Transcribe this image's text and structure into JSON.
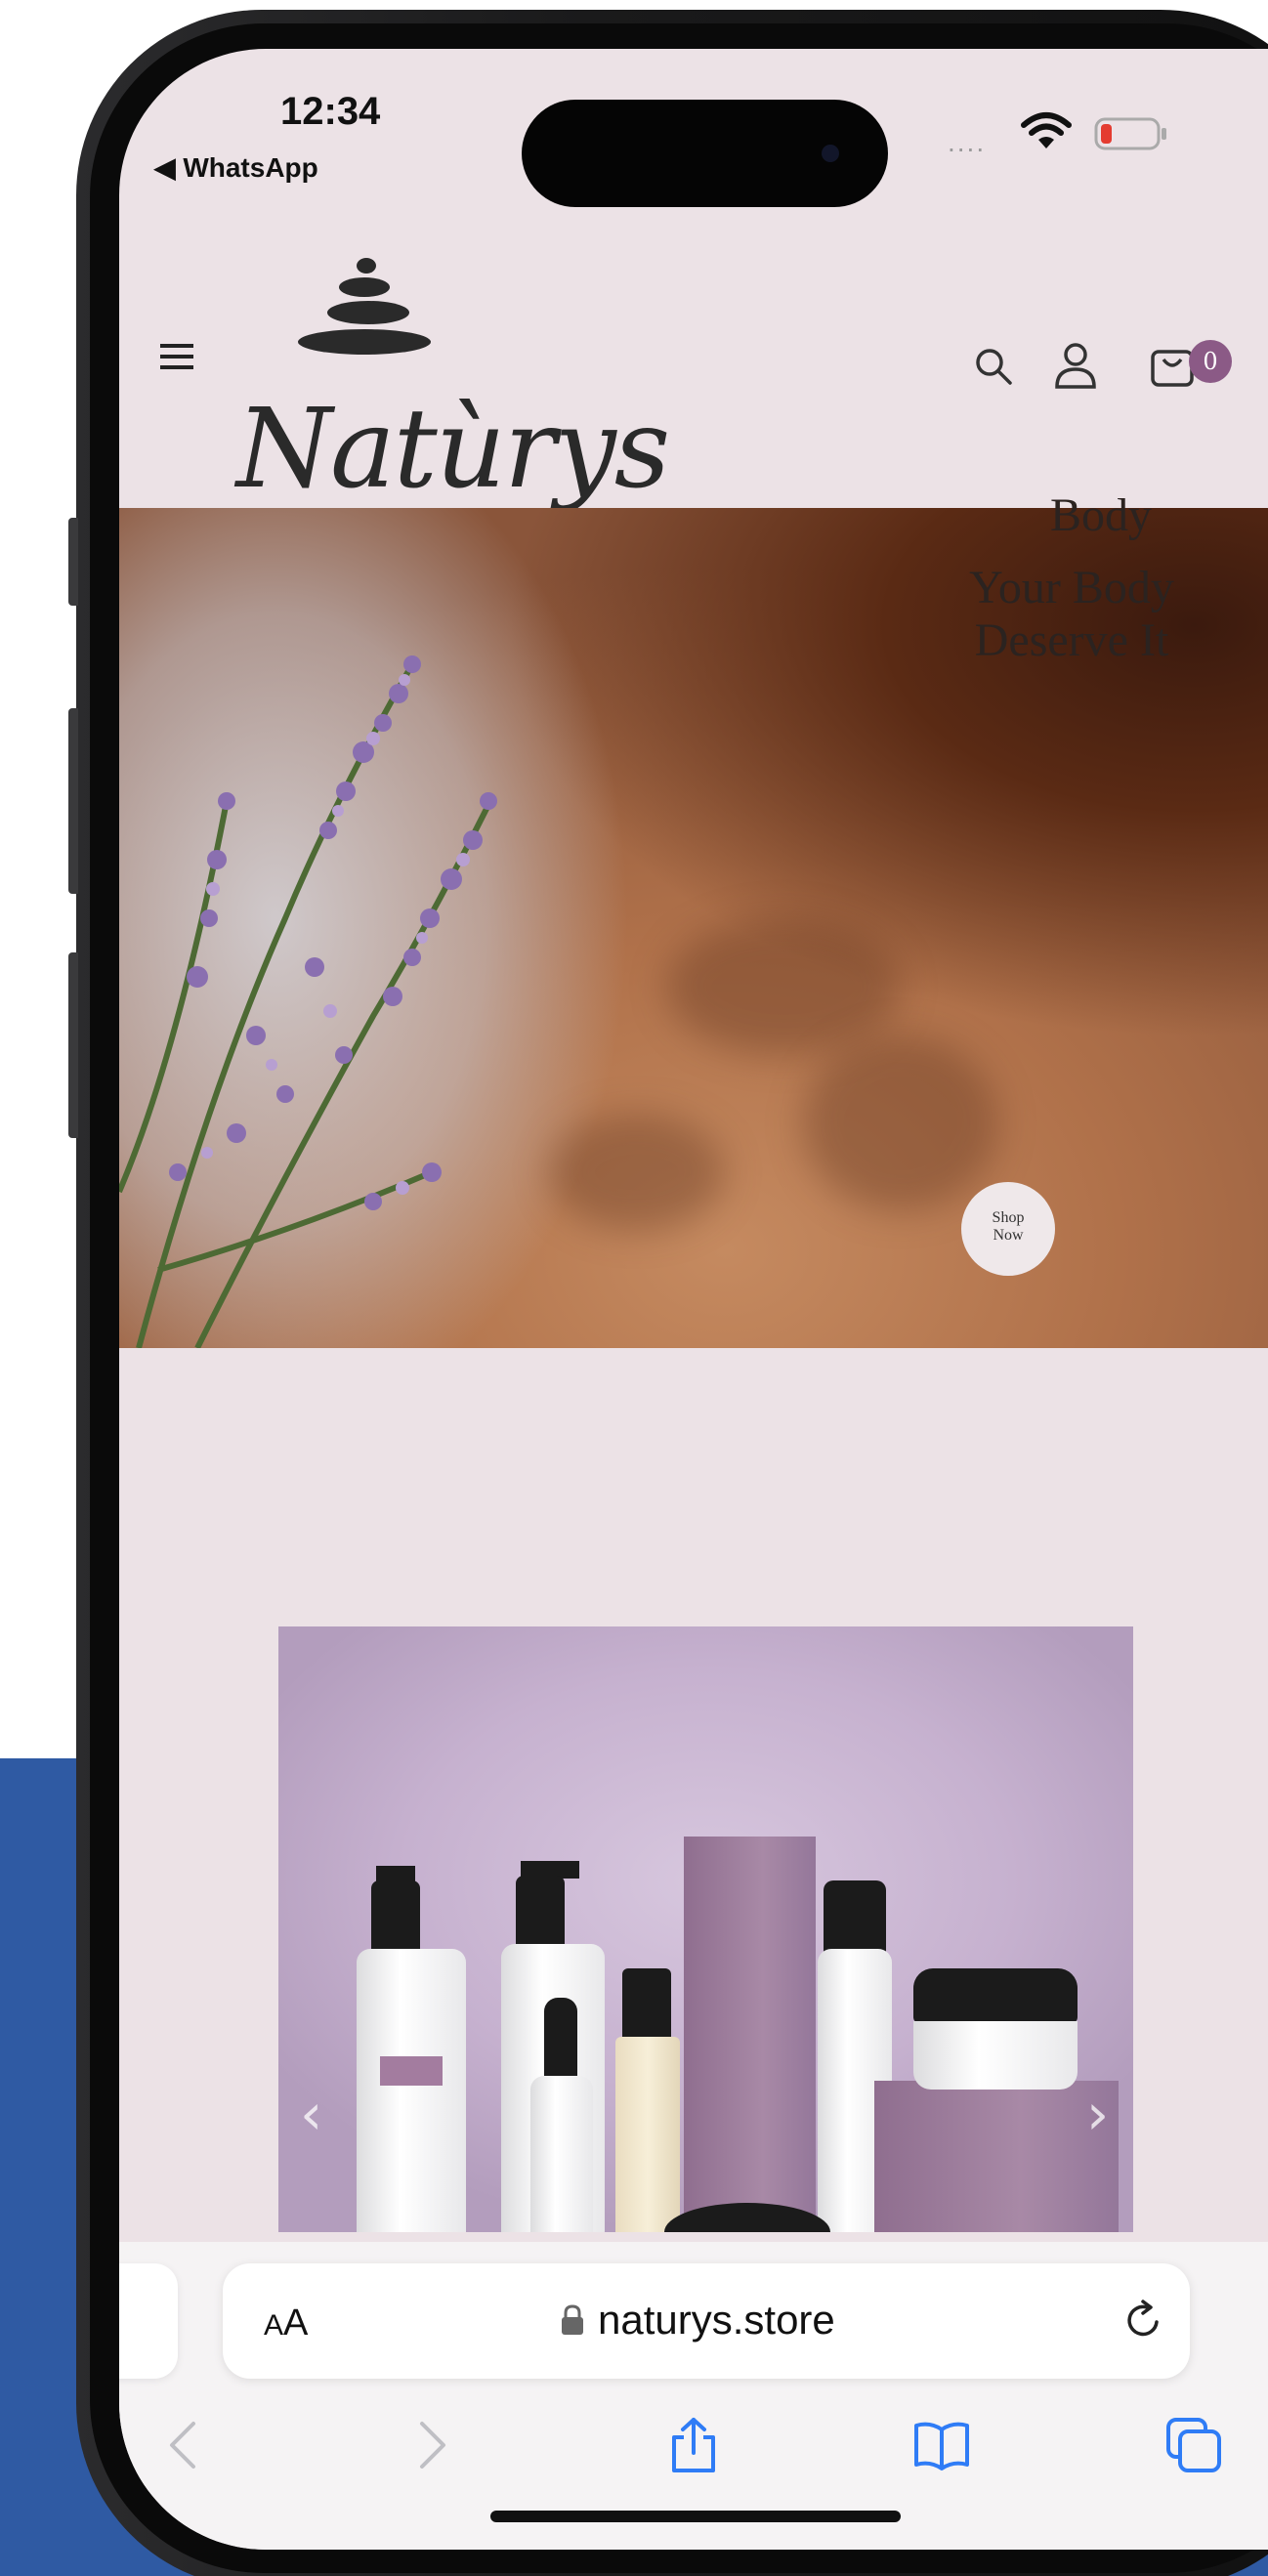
{
  "status_bar": {
    "time": "12:34",
    "back_app": "◀ WhatsApp",
    "signal": "....",
    "wifi_icon": "wifi-icon",
    "battery_icon": "battery-low-icon"
  },
  "site_header": {
    "logo_text": "Natùrys",
    "menu_icon": "hamburger-menu-icon",
    "search_icon": "search-icon",
    "account_icon": "account-icon",
    "cart_icon": "cart-icon",
    "cart_count": "0"
  },
  "hero": {
    "title": "Body",
    "subtitle_line1": "Your Body",
    "subtitle_line2": "Deserve It",
    "button_line1": "Shop",
    "button_line2": "Now"
  },
  "product_banner": {
    "prev_arrow": "‹",
    "next_arrow": "›"
  },
  "browser": {
    "text_size_label_big": "A",
    "text_size_label_small": "A",
    "url": "naturys.store",
    "toolbar": [
      "back-icon",
      "forward-icon",
      "share-icon",
      "bookmarks-icon",
      "tabs-icon"
    ]
  },
  "colors": {
    "page_bg": "#ece2e6",
    "accent_purple": "#8b5a86",
    "safari_blue": "#2f7cf6",
    "background_blue": "#2f5aa3"
  }
}
